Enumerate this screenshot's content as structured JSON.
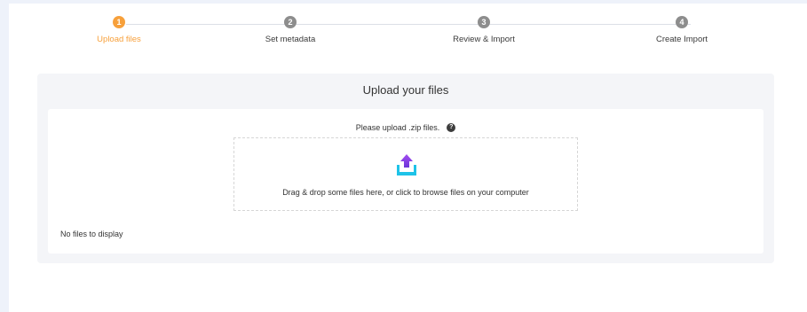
{
  "stepper": {
    "steps": [
      {
        "number": "1",
        "label": "Upload files",
        "active": true
      },
      {
        "number": "2",
        "label": "Set metadata",
        "active": false
      },
      {
        "number": "3",
        "label": "Review & Import",
        "active": false
      },
      {
        "number": "4",
        "label": "Create Import",
        "active": false
      }
    ],
    "active_color": "#f7a03b",
    "inactive_color": "#8d8d8d"
  },
  "upload": {
    "title": "Upload your files",
    "hint": "Please upload .zip files.",
    "help_icon": "question-circle-icon",
    "dropzone_text": "Drag & drop some files here, or click to browse files on your computer",
    "upload_icon": "upload-tray-icon",
    "empty_text": "No files to display"
  }
}
